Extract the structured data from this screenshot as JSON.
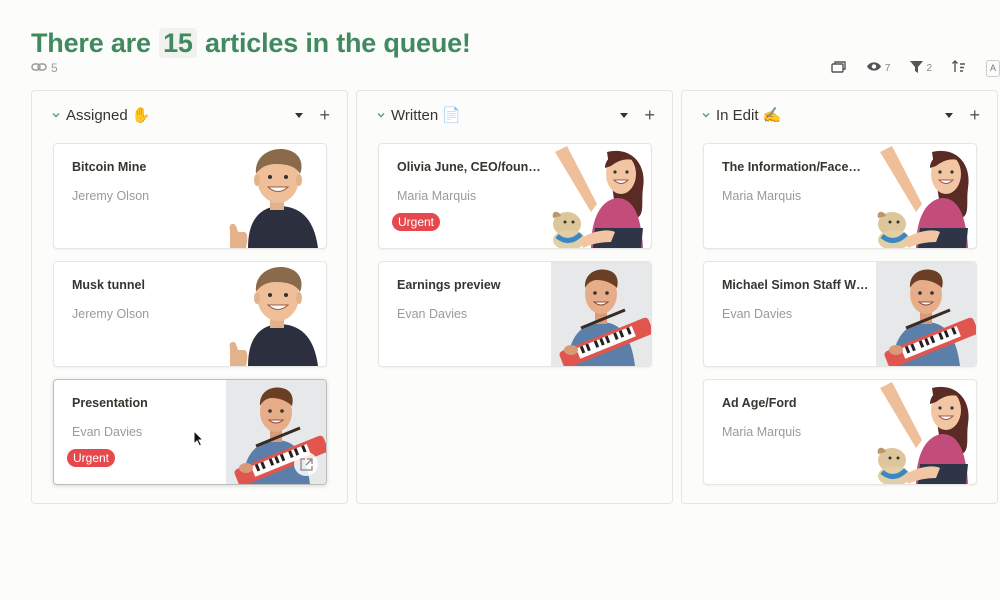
{
  "header": {
    "title_prefix": "There are",
    "title_count": "15",
    "title_suffix": "articles in the queue!",
    "link_count": "5"
  },
  "toolbar": {
    "views_count": "7",
    "filter_count": "2",
    "extra_label": "A"
  },
  "columns": [
    {
      "title": "Assigned",
      "emoji": "✋",
      "cards": [
        {
          "title": "Bitcoin Mine",
          "author": "Jeremy Olson",
          "tag": "",
          "avatar": "man-dark-shirt"
        },
        {
          "title": "Musk tunnel",
          "author": "Jeremy Olson",
          "tag": "",
          "avatar": "man-dark-shirt"
        },
        {
          "title": "Presentation",
          "author": "Evan Davies",
          "tag": "Urgent",
          "avatar": "man-keytar"
        }
      ]
    },
    {
      "title": "Written",
      "emoji": "📄",
      "cards": [
        {
          "title": "Olivia June, CEO/foun…",
          "author": "Maria Marquis",
          "tag": "Urgent",
          "avatar": "woman-dog"
        },
        {
          "title": "Earnings preview",
          "author": "Evan Davies",
          "tag": "",
          "avatar": "man-keytar"
        }
      ]
    },
    {
      "title": "In Edit",
      "emoji": "✍️",
      "cards": [
        {
          "title": "The Information/Face…",
          "author": "Maria Marquis",
          "tag": "",
          "avatar": "woman-dog"
        },
        {
          "title": "Michael Simon Staff W…",
          "author": "Evan Davies",
          "tag": "",
          "avatar": "man-keytar"
        },
        {
          "title": "Ad Age/Ford",
          "author": "Maria Marquis",
          "tag": "",
          "avatar": "woman-dog"
        }
      ]
    }
  ],
  "colors": {
    "title_green": "#418a5f",
    "urgent_red": "#e5484d",
    "chevron_green": "#4aa37a"
  }
}
